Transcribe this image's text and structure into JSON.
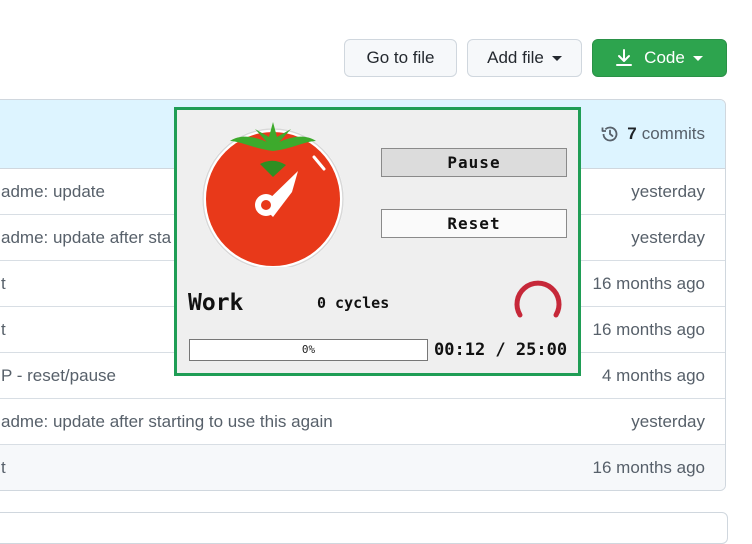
{
  "toolbar": {
    "goto_file": "Go to file",
    "add_file": "Add file",
    "code": "Code"
  },
  "header": {
    "commit_count": "7",
    "commits_label": "commits"
  },
  "rows": [
    {
      "message": "adme: update",
      "time": "yesterday"
    },
    {
      "message": "adme: update after sta",
      "time": "yesterday"
    },
    {
      "message": "t",
      "time": "16 months ago"
    },
    {
      "message": "t",
      "time": "16 months ago"
    },
    {
      "message": "P - reset/pause",
      "time": "4 months ago"
    },
    {
      "message": "adme: update after starting to use this again",
      "time": "yesterday"
    },
    {
      "message": "t",
      "time": "16 months ago"
    }
  ],
  "pomodoro": {
    "pause_label": "Pause",
    "reset_label": "Reset",
    "mode": "Work",
    "cycles": "0 cycles",
    "progress_label": "0%",
    "progress_fraction": 0,
    "timer": "00:12 / 25:00",
    "colors": {
      "border": "#1f9d55",
      "tomato": "#e8391a",
      "leaf": "#3daa2c",
      "spinner": "#c62839"
    }
  },
  "colors": {
    "code_button": "#2da44e",
    "header_bg": "#ddf4ff"
  }
}
